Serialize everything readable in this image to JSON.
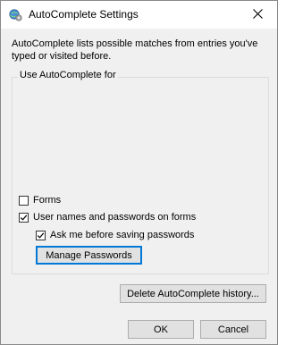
{
  "window": {
    "title": "AutoComplete Settings",
    "close_glyph": "×",
    "app_icon": "internet-explorer-settings-icon"
  },
  "description": "AutoComplete lists possible matches from entries you've typed or visited before.",
  "group": {
    "label": "Use AutoComplete for",
    "options": [
      {
        "label": "Forms",
        "checked": false
      },
      {
        "label": "User names and passwords on forms",
        "checked": true
      },
      {
        "label": "Ask me before saving passwords",
        "checked": true
      }
    ],
    "manage_button": "Manage Passwords"
  },
  "delete_history_button": "Delete AutoComplete history...",
  "ok_button": "OK",
  "cancel_button": "Cancel",
  "colors": {
    "focus_border": "#0078d7",
    "dialog_bg": "#f0f0f0",
    "button_bg": "#e1e1e1"
  }
}
